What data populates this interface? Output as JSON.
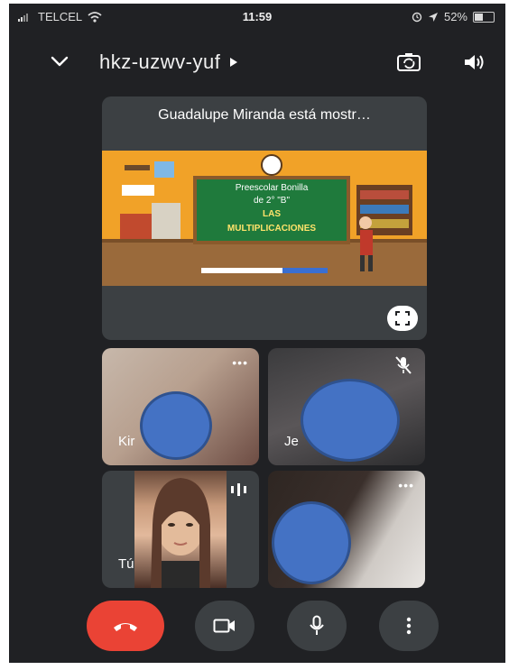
{
  "status_bar": {
    "carrier": "TELCEL",
    "time": "11:59",
    "battery_percent": "52%",
    "battery_level": 0.52
  },
  "header": {
    "meeting_code": "hkz-uzwv-yuf",
    "icons": [
      "chevron-down-icon",
      "play-arrow-icon",
      "switch-camera-icon",
      "speaker-icon"
    ]
  },
  "presentation": {
    "label": "Guadalupe Miranda está mostr…",
    "slide": {
      "line1": "Preescolar Bonilla",
      "line2": "de 2° \"B\"",
      "line3": "LAS",
      "line4": "MULTIPLICACIONES"
    }
  },
  "participants": [
    {
      "name": "Kir",
      "muted": false
    },
    {
      "name": "Je",
      "muted": true
    },
    {
      "name": "Tú",
      "speaking": true
    },
    {
      "name": ""
    }
  ],
  "controls": {
    "end_call": "end-call-icon",
    "camera": "video-camera-icon",
    "microphone": "microphone-icon",
    "more": "more-vert-icon"
  },
  "colors": {
    "background": "#202124",
    "tile": "#3c4043",
    "end_call": "#ea4335",
    "redaction": "#4472c4"
  }
}
